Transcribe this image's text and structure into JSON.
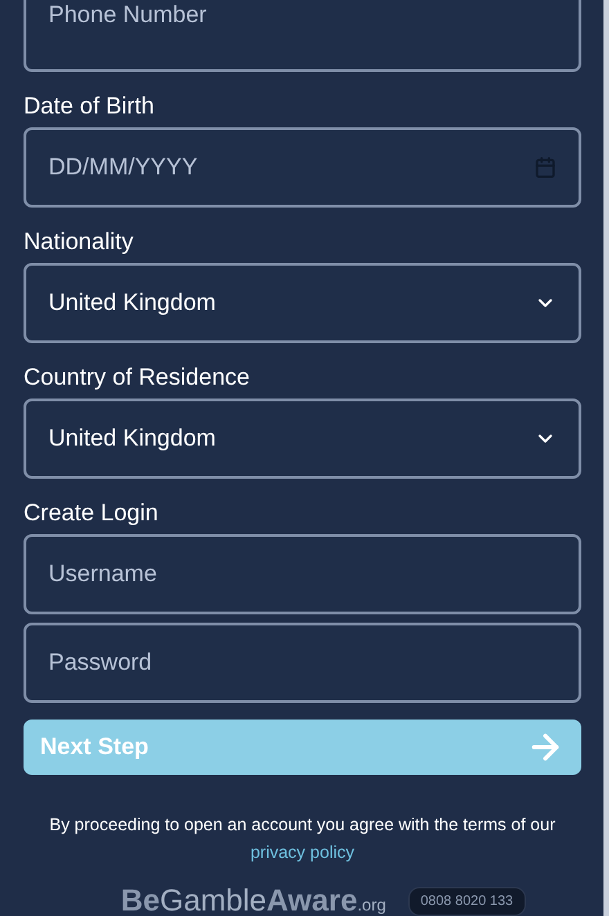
{
  "fields": [
    {
      "kind": "text",
      "placeholder": "Phone Number"
    },
    {
      "kind": "date",
      "label": "Date of Birth",
      "placeholder": "DD/MM/YYYY"
    },
    {
      "kind": "select",
      "label": "Nationality",
      "value": "United Kingdom"
    },
    {
      "kind": "select",
      "label": "Country of Residence",
      "value": "United Kingdom"
    },
    {
      "kind": "text",
      "label": "Create Login",
      "placeholder": "Username"
    },
    {
      "kind": "password",
      "placeholder": "Password"
    }
  ],
  "next_button": {
    "label": "Next Step"
  },
  "terms": {
    "text": "By proceeding to open an account you agree with the terms of our",
    "link": "privacy policy"
  },
  "footer": {
    "logo_bold": "Be",
    "logo_light": "Gamble",
    "logo_bold2": "Aware",
    "logo_suffix": ".org",
    "helpline": "0808 8020 133"
  }
}
